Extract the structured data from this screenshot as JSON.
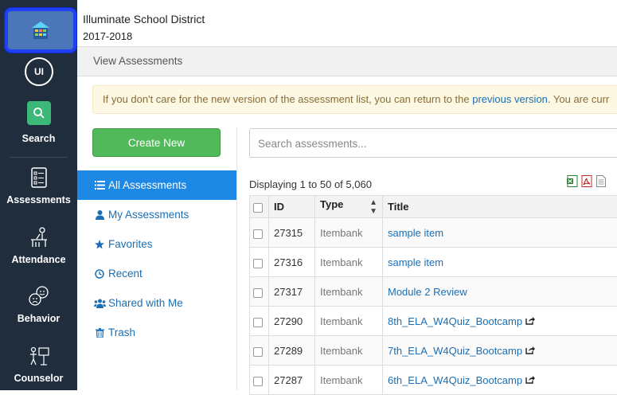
{
  "header": {
    "district": "Illuminate School District",
    "year": "2017-2018"
  },
  "breadcrumb": "View Assessments",
  "notice": {
    "text_before": "If you don't care for the new version of the assessment list, you can return to the",
    "link": "previous version",
    "text_after": ". You are curr"
  },
  "sidebar": {
    "avatar": "UI",
    "items": [
      {
        "label": "Search",
        "icon": "search-icon"
      },
      {
        "label": "Assessments",
        "icon": "assessments-icon"
      },
      {
        "label": "Attendance",
        "icon": "attendance-icon"
      },
      {
        "label": "Behavior",
        "icon": "behavior-icon"
      },
      {
        "label": "Counselor",
        "icon": "counselor-icon"
      }
    ]
  },
  "create_button": "Create New",
  "nav": [
    {
      "label": "All Assessments",
      "icon": "list-icon",
      "active": true
    },
    {
      "label": "My Assessments",
      "icon": "user-icon"
    },
    {
      "label": "Favorites",
      "icon": "star-icon"
    },
    {
      "label": "Recent",
      "icon": "clock-icon"
    },
    {
      "label": "Shared with Me",
      "icon": "users-icon"
    },
    {
      "label": "Trash",
      "icon": "trash-icon"
    }
  ],
  "search": {
    "placeholder": "Search assessments..."
  },
  "displaying": "Displaying 1 to 50 of 5,060",
  "table": {
    "headers": {
      "id": "ID",
      "type": "Type",
      "title": "Title"
    },
    "rows": [
      {
        "id": "27315",
        "type": "Itembank",
        "title": "sample item",
        "external": false
      },
      {
        "id": "27316",
        "type": "Itembank",
        "title": "sample item",
        "external": false
      },
      {
        "id": "27317",
        "type": "Itembank",
        "title": "Module 2 Review",
        "external": false
      },
      {
        "id": "27290",
        "type": "Itembank",
        "title": "8th_ELA_W4Quiz_Bootcamp",
        "external": true
      },
      {
        "id": "27289",
        "type": "Itembank",
        "title": "7th_ELA_W4Quiz_Bootcamp",
        "external": true
      },
      {
        "id": "27287",
        "type": "Itembank",
        "title": "6th_ELA_W4Quiz_Bootcamp",
        "external": true
      }
    ]
  },
  "colors": {
    "sidebar": "#1f2d3d",
    "accent": "#1e88e5",
    "create": "#52b95a",
    "link": "#1a6fb5"
  }
}
